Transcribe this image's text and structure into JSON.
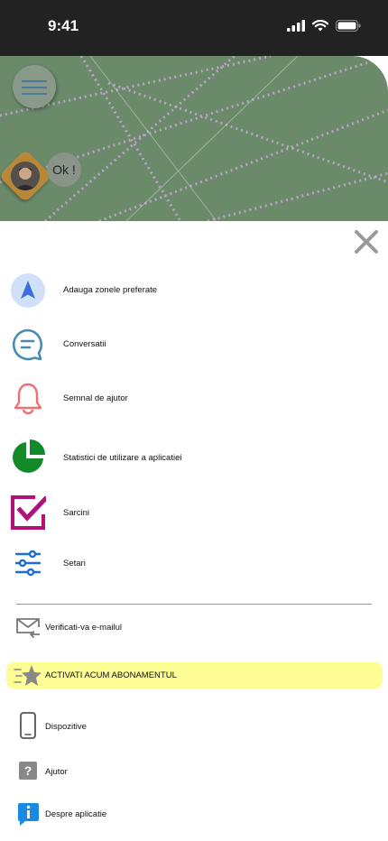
{
  "status_bar": {
    "time": "9:41"
  },
  "map": {
    "bubble_text": "Ok !"
  },
  "menu": [
    {
      "label": "Adauga zonele preferate",
      "icon": "navigation-arrow-icon"
    },
    {
      "label": "Conversatii",
      "icon": "chat-bubble-icon"
    },
    {
      "label": "Semnal de ajutor",
      "icon": "bell-icon"
    },
    {
      "label": "Statistici de utilizare a aplicatiei",
      "icon": "pie-chart-icon"
    },
    {
      "label": "Sarcini",
      "icon": "checkbox-icon"
    },
    {
      "label": "Setari",
      "icon": "sliders-icon"
    }
  ],
  "secondary": {
    "verify_email": "Verificati-va e-mailul",
    "subscription": "ACTIVATI ACUM ABONAMENTUL",
    "devices": "Dispozitive",
    "help": "Ajutor",
    "about": "Despre aplicatie"
  },
  "colors": {
    "status_bar": "#222222",
    "map": "#6a8a6a",
    "promo_bg": "#fdfd94",
    "nav_blue": "#3a6fe0",
    "chat_blue": "#4a8ab0",
    "bell_red": "#f07070",
    "pie_green": "#138a2a",
    "check_magenta": "#b0127a",
    "slider_blue": "#1a6fd0"
  }
}
